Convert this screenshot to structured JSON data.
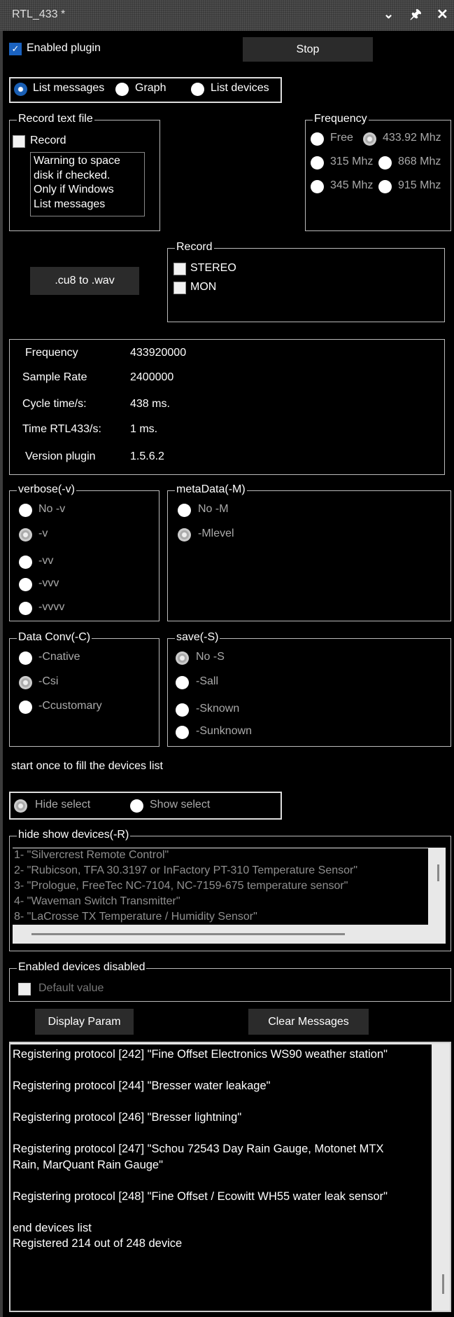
{
  "window": {
    "title": "RTL_433 *",
    "icons": [
      "chevron-down-icon",
      "pin-icon",
      "close-icon"
    ]
  },
  "top": {
    "enabled_label": "Enabled plugin",
    "enabled_checked": true,
    "stop_label": "Stop"
  },
  "view": {
    "options": [
      "List messages",
      "Graph",
      "List devices"
    ],
    "selected": "List messages"
  },
  "record_text": {
    "legend": "Record  text file",
    "record_label": "Record",
    "record_checked": false,
    "warning": [
      "Warning to space",
      "disk if checked.",
      "Only if Windows",
      "List messages"
    ]
  },
  "frequency": {
    "legend": "Frequency",
    "options": [
      "Free",
      "433.92 Mhz",
      "315 Mhz",
      "868 Mhz",
      "345 Mhz",
      "915 Mhz"
    ],
    "selected": "433.92 Mhz"
  },
  "convert": {
    "label": ".cu8 to .wav"
  },
  "record": {
    "legend": "Record",
    "stereo": "STEREO",
    "mon": "MON"
  },
  "info": {
    "rows": [
      {
        "label": "Frequency",
        "value": "433920000"
      },
      {
        "label": "Sample Rate",
        "value": "2400000"
      },
      {
        "label": "Cycle time/s:",
        "value": "438 ms."
      },
      {
        "label": "Time RTL433/s:",
        "value": "1 ms."
      },
      {
        "label": "Version plugin",
        "value": "1.5.6.2"
      }
    ]
  },
  "verbose": {
    "legend": "verbose(-v)",
    "options": [
      "No -v",
      "-v",
      "-vv",
      "-vvv",
      "-vvvv"
    ],
    "selected": "-v"
  },
  "metadata": {
    "legend": "metaData(-M)",
    "options": [
      "No -M",
      "-Mlevel"
    ],
    "selected": "-Mlevel"
  },
  "dataconv": {
    "legend": "Data Conv(-C)",
    "options": [
      "-Cnative",
      "-Csi",
      "-Ccustomary"
    ],
    "selected": "-Csi"
  },
  "save": {
    "legend": "save(-S)",
    "options": [
      "No -S",
      "-Sall",
      "-Sknown",
      "-Sunknown"
    ],
    "selected": "No -S"
  },
  "hint": "start once to fill  the devices list",
  "select": {
    "options": [
      "Hide select",
      "Show select"
    ],
    "selected": "Hide select"
  },
  "devices": {
    "legend": "hide show devices(-R)",
    "items": [
      "1- \"Silvercrest Remote Control\"",
      "2- \"Rubicson, TFA 30.3197 or InFactory PT-310 Temperature Sensor\"",
      "3- \"Prologue, FreeTec NC-7104, NC-7159-675 temperature sensor\"",
      "4- \"Waveman Switch Transmitter\"",
      "8- \"LaCrosse TX Temperature / Humidity Sensor\""
    ]
  },
  "enabled_devices": {
    "legend": "Enabled devices disabled",
    "default_label": "Default value"
  },
  "buttons": {
    "display_param": "Display Param",
    "clear_messages": "Clear Messages"
  },
  "messages": [
    "Registering protocol [242] \"Fine Offset Electronics WS90 weather station\"",
    "",
    "Registering protocol [244] \"Bresser water leakage\"",
    "",
    "Registering protocol [246] \"Bresser lightning\"",
    "",
    "Registering protocol [247] \"Schou 72543 Day Rain Gauge, Motonet MTX",
    "Rain, MarQuant Rain Gauge\"",
    "",
    "Registering protocol [248] \"Fine Offset / Ecowitt WH55 water leak sensor\"",
    "",
    "end devices list",
    "Registered 214 out of 248 device"
  ]
}
